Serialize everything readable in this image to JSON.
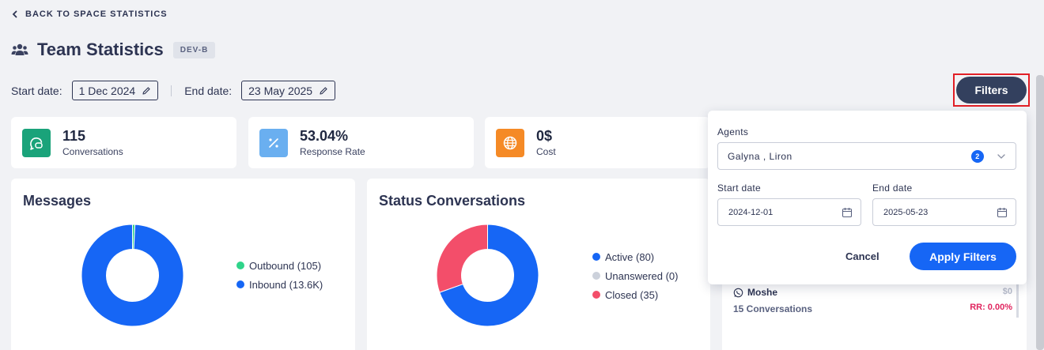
{
  "nav": {
    "back_label": "BACK TO SPACE STATISTICS"
  },
  "header": {
    "title": "Team Statistics",
    "badge": "DEV-B"
  },
  "date_range": {
    "start_label": "Start date:",
    "start_value": "1 Dec 2024",
    "end_label": "End date:",
    "end_value": "23 May 2025"
  },
  "filters_button": {
    "label": "Filters"
  },
  "stats": [
    {
      "value": "115",
      "label": "Conversations",
      "color": "#1aa37a",
      "icon": "conversations-icon"
    },
    {
      "value": "53.04%",
      "label": "Response Rate",
      "color": "#6aaff0",
      "icon": "percent-icon"
    },
    {
      "value": "0$",
      "label": "Cost",
      "color": "#f58a26",
      "icon": "globe-icon"
    }
  ],
  "messages_panel": {
    "title": "Messages",
    "legend": [
      {
        "label": "Outbound (105)",
        "color": "#2fd48a",
        "value": 105
      },
      {
        "label": "Inbound (13.6K)",
        "color": "#1666f5",
        "value": 13600
      }
    ]
  },
  "status_panel": {
    "title": "Status Conversations",
    "legend": [
      {
        "label": "Active (80)",
        "color": "#1666f5",
        "value": 80
      },
      {
        "label": "Unanswered (0)",
        "color": "#ccd1db",
        "value": 0
      },
      {
        "label": "Closed (35)",
        "color": "#f34e6a",
        "value": 35
      }
    ]
  },
  "agent_card": {
    "name": "Moshe",
    "cost": "$0",
    "conversations": "15 Conversations",
    "rr": "RR: 0.00%"
  },
  "filter_popover": {
    "agents_label": "Agents",
    "agents_value": "Galyna , Liron",
    "agents_count": "2",
    "start_label": "Start date",
    "start_value": "2024-12-01",
    "end_label": "End date",
    "end_value": "2025-05-23",
    "cancel_label": "Cancel",
    "apply_label": "Apply Filters"
  }
}
